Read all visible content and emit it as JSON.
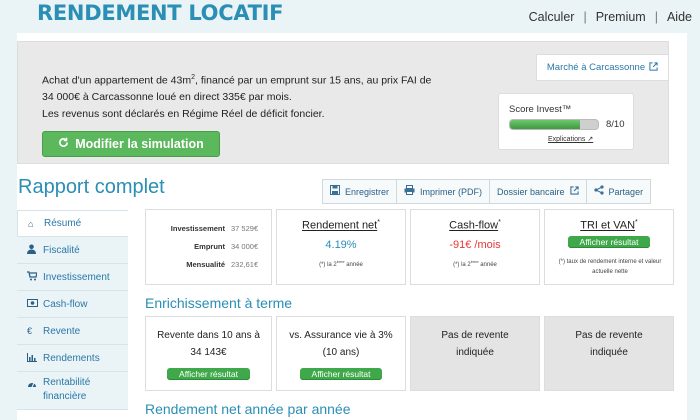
{
  "header": {
    "logo": "RENDEMENT LOCATIF",
    "nav": [
      "Calculer",
      "Premium",
      "Aide"
    ]
  },
  "banner": {
    "line1_a": "Achat d'un appartement de 43m",
    "line1_sup": "2",
    "line1_b": ", financé par un emprunt sur 15 ans, au prix FAI de",
    "line2": "34 000€ à Carcassonne loué en direct 335€ par mois.",
    "line3": "Les revenus sont déclarés en Régime Réel de déficit foncier.",
    "modify_button": "Modifier la simulation",
    "marche_link": "Marché à Carcassonne",
    "score": {
      "title": "Score Invest™",
      "value": "8/10",
      "fraction": 0.8,
      "explanations": "Explications"
    }
  },
  "rapport": {
    "title": "Rapport complet",
    "actions": [
      {
        "label": "Enregistrer",
        "icon": "save-icon"
      },
      {
        "label": "Imprimer (PDF)",
        "icon": "print-icon"
      },
      {
        "label": "Dossier bancaire",
        "icon": "external-link-icon"
      },
      {
        "label": "Partager",
        "icon": "share-icon"
      }
    ]
  },
  "sidebar": {
    "items": [
      {
        "label": "Résumé",
        "icon": "home-icon"
      },
      {
        "label": "Fiscalité",
        "icon": "user-icon"
      },
      {
        "label": "Investissement",
        "icon": "cart-icon"
      },
      {
        "label": "Cash-flow",
        "icon": "cash-icon"
      },
      {
        "label": "Revente",
        "icon": "euro-icon"
      },
      {
        "label": "Rendements",
        "icon": "bar-chart-icon"
      },
      {
        "label": "Rentabilité financière",
        "icon": "dashboard-icon"
      }
    ]
  },
  "summary": {
    "investissement": {
      "label": "Investissement",
      "value": "37 529€"
    },
    "emprunt": {
      "label": "Emprunt",
      "value": "34 000€"
    },
    "mensualite": {
      "label": "Mensualité",
      "value": "232,61€"
    },
    "rendement": {
      "title": "Rendement net",
      "value": "4.19%",
      "note_a": "(*) la 2",
      "note_sup": "ème",
      "note_b": " année"
    },
    "cashflow": {
      "title": "Cash-flow",
      "value": "-91€ /mois",
      "note_a": "(*) la 2",
      "note_sup": "ème",
      "note_b": " année"
    },
    "tri": {
      "title": "TRI et VAN",
      "button": "Afficher résultat",
      "note": "(*) taux de rendement interne et valeur actuelle nette"
    },
    "asterisk": "*"
  },
  "enrichissement": {
    "title": "Enrichissement à terme",
    "cards": [
      {
        "line1": "Revente dans 10 ans à",
        "line2": "34 143€",
        "button": "Afficher résultat"
      },
      {
        "line1": "vs. Assurance vie à 3%",
        "line2": "(10 ans)",
        "button": "Afficher résultat"
      },
      {
        "line1": "Pas de revente",
        "line2": "indiquée"
      },
      {
        "line1": "Pas de revente",
        "line2": "indiquée"
      }
    ]
  },
  "rendement_section": {
    "title": "Rendement net année par année"
  },
  "colors": {
    "accent": "#2a8eb5",
    "green": "#5cb85c",
    "negative": "#e53935",
    "positive": "#2a8eb5"
  }
}
